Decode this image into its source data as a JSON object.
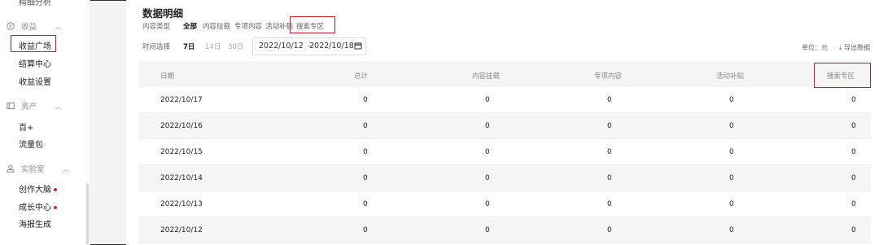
{
  "sidebar": {
    "partial_top": "精细分析",
    "groups": [
      {
        "label": "收益",
        "icon": "coin-icon"
      },
      {
        "label": "资产",
        "icon": "wallet-icon"
      },
      {
        "label": "实验室",
        "icon": "lab-icon"
      }
    ],
    "income_items": [
      "收益广场",
      "结算中心",
      "收益设置"
    ],
    "asset_items": [
      "百+",
      "流量包"
    ],
    "lab_items": [
      "创作大脑",
      "成长中心",
      "海报生成"
    ],
    "active_item": "收益广场"
  },
  "main": {
    "title": "数据明细",
    "content_type_label": "内容类型",
    "content_filters": [
      "全部",
      "内容挂载",
      "专项内容",
      "活动补贴",
      "搜索专区"
    ],
    "active_filter": "全部",
    "highlighted_filter": "搜索专区",
    "time_label": "时间选择",
    "day_options": [
      "7日",
      "14日",
      "30日"
    ],
    "active_day": "7日",
    "date_start": "2022/10/12",
    "date_sep": "—",
    "date_end": "2022/10/18",
    "unit": "单位：元",
    "export": "导出数据"
  },
  "table": {
    "columns": [
      "日期",
      "总计",
      "内容挂载",
      "专项内容",
      "活动补贴",
      "搜索专区"
    ],
    "rows": [
      [
        "2022/10/17",
        "0",
        "0",
        "0",
        "0",
        "0"
      ],
      [
        "2022/10/16",
        "0",
        "0",
        "0",
        "0",
        "0"
      ],
      [
        "2022/10/15",
        "0",
        "0",
        "0",
        "0",
        "0"
      ],
      [
        "2022/10/14",
        "0",
        "0",
        "0",
        "0",
        "0"
      ],
      [
        "2022/10/13",
        "0",
        "0",
        "0",
        "0",
        "0"
      ],
      [
        "2022/10/12",
        "0",
        "0",
        "0",
        "0",
        "0"
      ]
    ]
  },
  "colors": {
    "highlight": "#c81f1f",
    "active_dot": "#e02020"
  }
}
